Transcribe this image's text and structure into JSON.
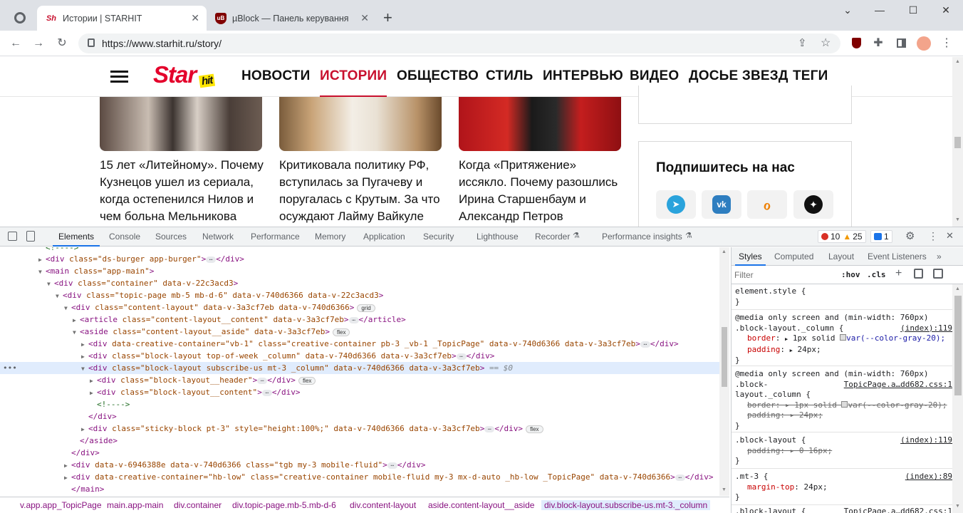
{
  "browser": {
    "tabs": [
      {
        "favicon": "Sh",
        "title": "Истории | STARHIT",
        "active": true
      },
      {
        "favicon": "uB",
        "title": "µBlock — Панель керування",
        "active": false
      }
    ],
    "new_tab": "+",
    "window_controls": {
      "minimize": "—",
      "maximize": "☐",
      "close": "✕",
      "tab_search": "⌄"
    },
    "url": "https://www.starhit.ru/story/"
  },
  "site": {
    "logo_main": "Star",
    "logo_sub": "hit",
    "nav": [
      "НОВОСТИ",
      "ИСТОРИИ",
      "ОБЩЕСТВО",
      "СТИЛЬ",
      "ИНТЕРВЬЮ",
      "ВИДЕО",
      "ДОСЬЕ ЗВЕЗД",
      "ТЕГИ"
    ],
    "active_nav": "ИСТОРИИ",
    "cards": [
      {
        "title": "15 лет «Литейному». Почему Кузнецов ушел из сериала, когда остепенился Нилов и чем больна Мельникова"
      },
      {
        "title": "Критиковала политику РФ, вступилась за Пугачеву и поругалась с Крутым. За что осуждают Лайму Вайкуле"
      },
      {
        "title": "Когда «Притяжение» иссякло. Почему разошлись Ирина Старшенбаум и Александр Петров"
      }
    ],
    "subscribe_title": "Подпишитесь на нас",
    "socials": [
      "telegram",
      "vk",
      "ok",
      "dzen"
    ],
    "colors": {
      "brand": "#e4002b",
      "accent_yellow": "#ffe600"
    }
  },
  "devtools": {
    "tabs": [
      "Elements",
      "Console",
      "Sources",
      "Network",
      "Performance",
      "Memory",
      "Application",
      "Security",
      "Lighthouse",
      "Recorder",
      "Performance insights"
    ],
    "active_tab": "Elements",
    "errors": "10",
    "warnings": "25",
    "messages": "1",
    "elements": [
      {
        "text": "<!---->",
        "indent": 0
      },
      {
        "tag": "div",
        "attrs": " class=\"ds-burger app-burger\"",
        "close": "</div>",
        "collapsed": true
      },
      {
        "tag": "main",
        "attrs": " class=\"app-main\""
      },
      {
        "tag": "div",
        "attrs": " class=\"container\" data-v-22c3acd3"
      },
      {
        "tag": "div",
        "attrs": " class=\"topic-page mb-5 mb-d-6\" data-v-740d6366 data-v-22c3acd3"
      },
      {
        "tag": "div",
        "attrs": " class=\"content-layout\" data-v-3a3cf7eb data-v-740d6366",
        "pill": "grid"
      },
      {
        "tag": "article",
        "attrs": " class=\"content-layout__content\" data-v-3a3cf7eb",
        "close": "</article>",
        "collapsed": true
      },
      {
        "tag": "aside",
        "attrs": " class=\"content-layout__aside\" data-v-3a3cf7eb",
        "pill": "flex"
      },
      {
        "tag": "div",
        "attrs": " data-creative-container=\"vb-1\" class=\"creative-container pb-3 _vb-1 _TopicPage\" data-v-740d6366 data-v-3a3cf7eb",
        "close": "</div>",
        "collapsed": true
      },
      {
        "tag": "div",
        "attrs": " class=\"block-layout top-of-week _column\" data-v-740d6366 data-v-3a3cf7eb",
        "close": "</div>",
        "collapsed": true
      },
      {
        "tag": "div",
        "attrs": " class=\"block-layout subscribe-us mt-3 _column\" data-v-740d6366 data-v-3a3cf7eb",
        "dollar": "== $0"
      },
      {
        "tag": "div",
        "attrs": " class=\"block-layout__header\"",
        "close": "</div>",
        "collapsed": true,
        "pill": "flex"
      },
      {
        "tag": "div",
        "attrs": " class=\"block-layout__content\"",
        "close": "</div>",
        "collapsed": true
      },
      {
        "text": "<!---->"
      },
      {
        "text": "</div>"
      },
      {
        "tag": "div",
        "attrs": " class=\"sticky-block pt-3\" style=\"height:100%;\" data-v-740d6366 data-v-3a3cf7eb",
        "close": "</div>",
        "collapsed": true,
        "pill": "flex"
      },
      {
        "text": "</aside>"
      },
      {
        "text": "</div>"
      },
      {
        "tag": "div",
        "attrs": " data-v-6946388e data-v-740d6366 class=\"tgb my-3 mobile-fluid\"",
        "close": "</div>",
        "collapsed": true
      },
      {
        "tag": "div",
        "attrs": " data-creative-container=\"hb-low\" class=\"creative-container mobile-fluid my-3 mx-d-auto _hb-low _TopicPage\" data-v-740d6366",
        "close": "</div>",
        "collapsed": true
      },
      {
        "text": "</main>"
      }
    ],
    "breadcrumbs": [
      "v.app.app_TopicPage",
      "main.app-main",
      "div.container",
      "div.topic-page.mb-5.mb-d-6",
      "div.content-layout",
      "aside.content-layout__aside",
      "div.block-layout.subscribe-us.mt-3._column"
    ],
    "styles": {
      "tabs": [
        "Styles",
        "Computed",
        "Layout",
        "Event Listeners",
        "»"
      ],
      "filter_placeholder": "Filter",
      "hov": ":hov",
      "cls": ".cls",
      "element_style": "element.style {",
      "close_brace": "}",
      "media1": "@media only screen and (min-width: 760px)",
      "sel1": ".block-layout._column {",
      "src1": "(index):119",
      "r1_border_name": "border",
      "r1_border_val": "1px solid",
      "r1_border_var": "var(--color-gray-20);",
      "r1_padding_name": "padding",
      "r1_padding_val": "24px;",
      "media2": "@media only screen and (min-width: 760px)",
      "sel2a": ".block-",
      "sel2b": "layout._column {",
      "src2": "TopicPage.a…dd682.css:1",
      "r2_border": "border: ▸ 1px solid ",
      "r2_border_var": "var(--color-gray-20);",
      "r2_padding": "padding: ▸ 24px;",
      "sel3": ".block-layout {",
      "src3": "(index):119",
      "r3_padding": "padding: ▸ 0 16px;",
      "sel4": ".mt-3 {",
      "src4": "(index):89",
      "r4_margin_name": "margin-top",
      "r4_margin_val": "24px;",
      "sel5": ".block-layout {",
      "src5": "TopicPage.a…dd682.css:1"
    }
  }
}
